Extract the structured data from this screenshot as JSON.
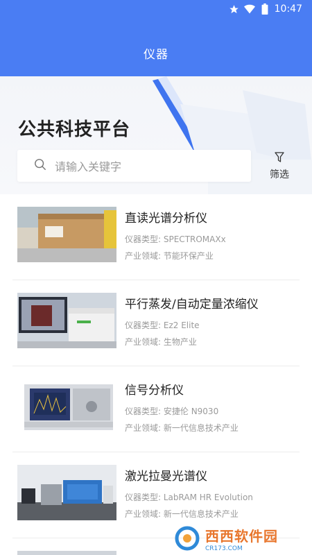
{
  "status_bar": {
    "time": "10:47",
    "icons": [
      "star-icon",
      "wifi-icon",
      "battery-icon"
    ]
  },
  "nav": {
    "title": "仪器"
  },
  "hero": {
    "title": "公共科技平台"
  },
  "search": {
    "placeholder": "请输入关键字",
    "icon": "search-icon"
  },
  "filter": {
    "label": "筛选",
    "icon": "filter-icon"
  },
  "items": [
    {
      "name": "直读光谱分析仪",
      "type_label": "仪器类型:",
      "type_value": "SPECTROMAXx",
      "field_label": "产业领域:",
      "field_value": "节能环保产业"
    },
    {
      "name": "平行蒸发/自动定量浓缩仪",
      "type_label": "仪器类型:",
      "type_value": "Ez2 Elite",
      "field_label": "产业领域:",
      "field_value": "生物产业"
    },
    {
      "name": "信号分析仪",
      "type_label": "仪器类型:",
      "type_value": "安捷伦 N9030",
      "field_label": "产业领域:",
      "field_value": "新一代信息技术产业"
    },
    {
      "name": "激光拉曼光谱仪",
      "type_label": "仪器类型:",
      "type_value": "LabRAM HR Evolution",
      "field_label": "产业领域:",
      "field_value": "新一代信息技术产业"
    }
  ],
  "watermark": {
    "text": "西西软件园",
    "sub": "CR173.COM"
  },
  "colors": {
    "primary": "#4a7df3"
  }
}
